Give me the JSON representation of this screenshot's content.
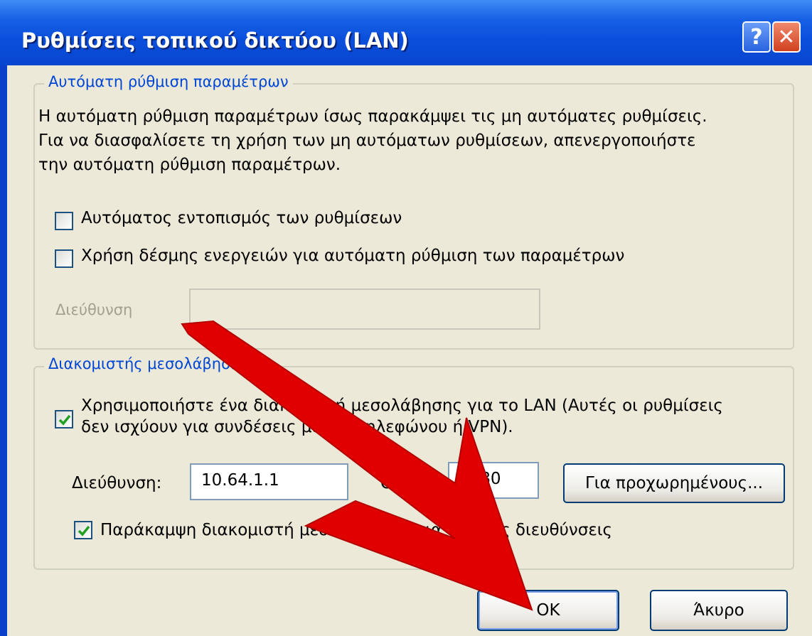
{
  "window": {
    "title": "Ρυθμίσεις τοπικού δικτύου (LAN)",
    "help_label": "?",
    "close_label": "✕"
  },
  "auto_config": {
    "legend": "Αυτόματη ρύθμιση παραμέτρων",
    "description_lines": [
      "Η αυτόματη ρύθμιση παραμέτρων ίσως παρακάμψει τις μη αυτόματες ρυθμίσεις.",
      "Για να διασφαλίσετε τη χρήση των μη αυτόματων ρυθμίσεων, απενεργοποιήστε",
      "την αυτόματη ρύθμιση παραμέτρων."
    ],
    "auto_detect_label": "Αυτόματος εντοπισμός των ρυθμίσεων",
    "auto_detect_checked": false,
    "use_script_label": "Χρήση δέσμης ενεργειών για αυτόματη ρύθμιση των παραμέτρων",
    "use_script_checked": false,
    "address_label": "Διεύθυνση",
    "address_value": ""
  },
  "proxy": {
    "legend": "Διακομιστής μεσολάβησης",
    "use_proxy_checked": true,
    "use_proxy_lines": [
      "Χρησιμοποιήστε ένα διακομιστή μεσολάβησης για το LAN (Αυτές οι ρυθμίσεις",
      "δεν ισχύουν για συνδέσεις μέσου τηλεφώνου ή VPN)."
    ],
    "address_label": "Διεύθυνση:",
    "address_value": "10.64.1.1",
    "port_label": "Θύρα:",
    "port_value": "8080",
    "advanced_label": "Για προχωρημένους...",
    "bypass_checked": true,
    "bypass_label": "Παράκαμψη διακομιστή μεσολάβησης για τοπικές διευθύνσεις"
  },
  "buttons": {
    "ok_label": "OK",
    "cancel_label": "Άκυρο"
  },
  "colors": {
    "title_bar": "#0a4fdc",
    "dialog_background": "#ece9d8",
    "legend_text": "#0046d5",
    "annotation_arrow": "#e60000"
  },
  "icons": [
    "help-icon",
    "close-icon",
    "check-icon",
    "red-arrow-annotation"
  ]
}
